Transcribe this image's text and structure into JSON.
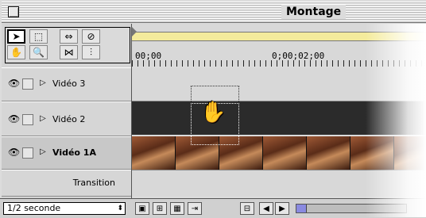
{
  "window": {
    "title": "Montage"
  },
  "tools": [
    {
      "name": "selection-tool",
      "glyph": "➤"
    },
    {
      "name": "marquee-tool",
      "glyph": "⬚"
    },
    {
      "name": "track-tool",
      "glyph": "⇔"
    },
    {
      "name": "razor-tool",
      "glyph": "⊘"
    },
    {
      "name": "hand-tool",
      "glyph": "✋"
    },
    {
      "name": "zoom-tool",
      "glyph": "🔍"
    },
    {
      "name": "link-tool",
      "glyph": "⋈"
    },
    {
      "name": "in-out-tool",
      "glyph": "⫶"
    }
  ],
  "ruler": {
    "start_time": "00;00",
    "second_time": "0;00;02;00"
  },
  "tracks": [
    {
      "label": "Vidéo 3"
    },
    {
      "label": "Vidéo 2"
    },
    {
      "label": "Vidéo 1A"
    },
    {
      "label": "Transition"
    }
  ],
  "bottombar": {
    "time_unit": "1/2 seconde",
    "buttons": [
      "▣",
      "⊞",
      "▦",
      "⇥",
      "⊟",
      "◀",
      "▶"
    ]
  }
}
